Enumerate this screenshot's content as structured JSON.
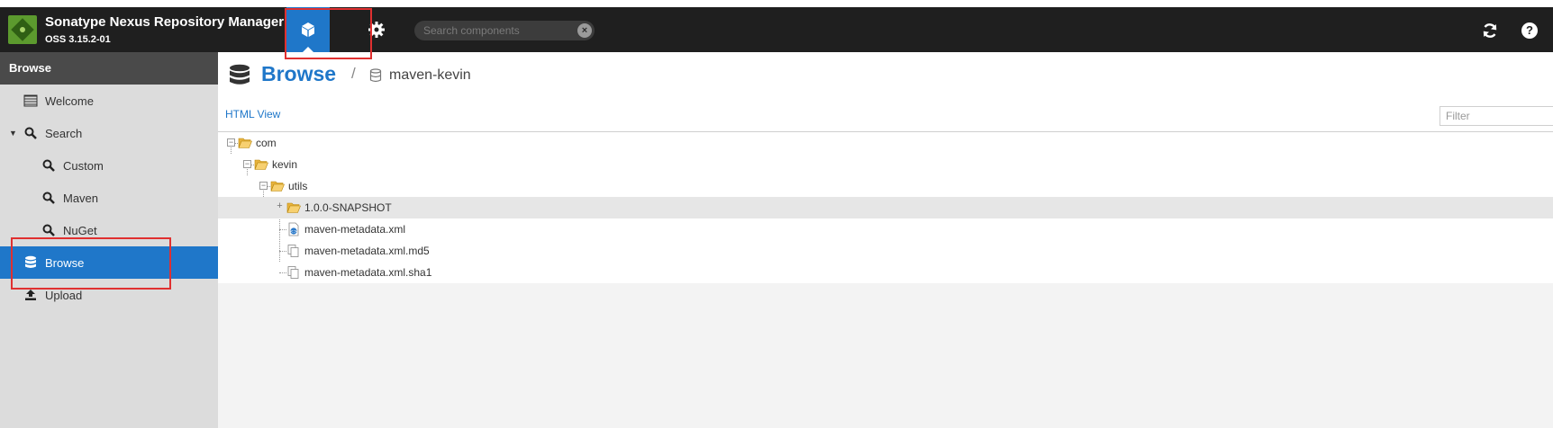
{
  "header": {
    "app_title": "Sonatype Nexus Repository Manager",
    "version": "OSS 3.15.2-01",
    "search_placeholder": "Search components",
    "modes": [
      {
        "name": "browse",
        "icon": "cube-icon",
        "active": true
      },
      {
        "name": "administration",
        "icon": "gear-icon",
        "active": false
      }
    ],
    "right_icons": [
      "refresh-icon",
      "help-icon"
    ]
  },
  "sidebar": {
    "title": "Browse",
    "items": [
      {
        "label": "Welcome",
        "icon": "list-icon"
      },
      {
        "label": "Search",
        "icon": "search-icon",
        "expanded": true
      },
      {
        "label": "Custom",
        "icon": "search-icon"
      },
      {
        "label": "Maven",
        "icon": "search-icon"
      },
      {
        "label": "NuGet",
        "icon": "search-icon"
      },
      {
        "label": "Browse",
        "icon": "database-icon",
        "active": true
      },
      {
        "label": "Upload",
        "icon": "upload-icon"
      }
    ]
  },
  "main": {
    "title": "Browse",
    "breadcrumb_separator": "/",
    "repository": "maven-kevin",
    "html_view_label": "HTML View",
    "filter_placeholder": "Filter",
    "tree": [
      {
        "label": "com",
        "type": "folder-open",
        "expanded": true
      },
      {
        "label": "kevin",
        "type": "folder-open",
        "expanded": true
      },
      {
        "label": "utils",
        "type": "folder-open",
        "expanded": true
      },
      {
        "label": "1.0.0-SNAPSHOT",
        "type": "folder-open",
        "expanded": false,
        "selected": true
      },
      {
        "label": "maven-metadata.xml",
        "type": "xml-file"
      },
      {
        "label": "maven-metadata.xml.md5",
        "type": "file"
      },
      {
        "label": "maven-metadata.xml.sha1",
        "type": "file"
      }
    ]
  },
  "colors": {
    "accent": "#1f77c9",
    "header_bg": "#1f1f1f",
    "sidebar_bg": "#dcdcdc",
    "highlight": "#e03030",
    "folder": "#f2c14e"
  }
}
